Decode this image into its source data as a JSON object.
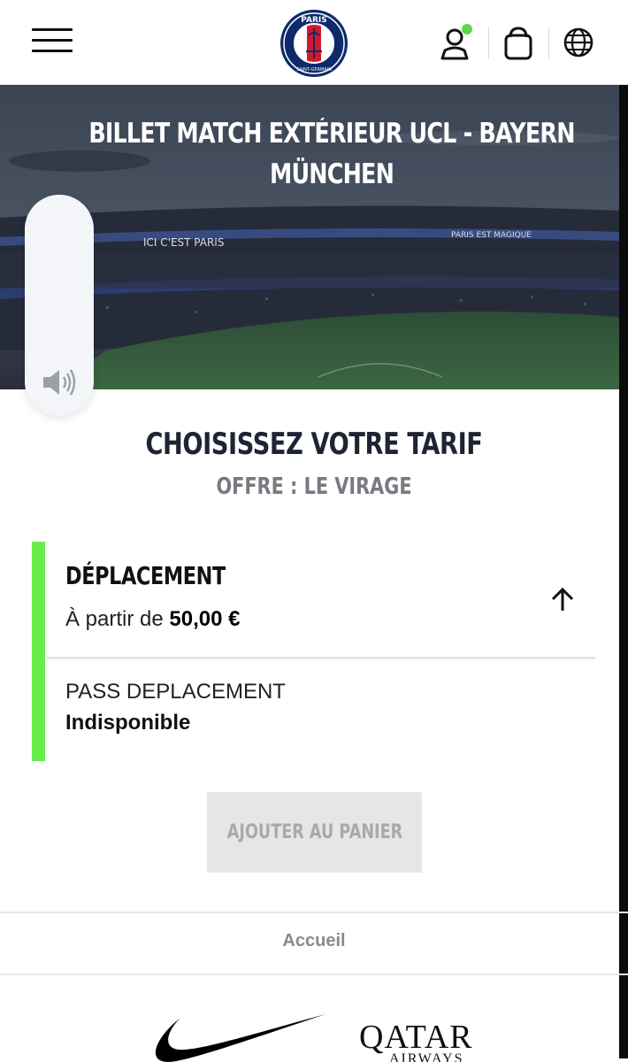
{
  "header": {
    "logo": {
      "top_text": "PARIS",
      "bottom_text": "SAINT-GERMAIN"
    },
    "icons": [
      "menu-icon",
      "account-icon",
      "bag-icon",
      "globe-icon"
    ],
    "account_badge_color": "#5dd94a"
  },
  "hero": {
    "title": "BILLET MATCH EXTÉRIEUR UCL - BAYERN MÜNCHEN",
    "title_line1": "BILLET MATCH EXTÉRIEUR UCL - BAYERN",
    "title_line2": "MÜNCHEN",
    "stadium_banners": [
      "ICI C'EST PARIS",
      "PARIS EST MAGIQUE"
    ]
  },
  "selection": {
    "title": "CHOISISSEZ VOTRE TARIF",
    "offer": "OFFRE : LE VIRAGE"
  },
  "tariff": {
    "category": "DÉPLACEMENT",
    "from_label": "À partir de",
    "from_price": "50,00 €",
    "accent_color": "#66ee4a",
    "items": [
      {
        "name": "PASS DEPLACEMENT",
        "status": "Indisponible"
      }
    ]
  },
  "cart": {
    "add_label": "AJOUTER AU PANIER"
  },
  "footer": {
    "breadcrumb": "Accueil",
    "sponsors": {
      "nike": "nike-swoosh-logo",
      "qatar_main": "QATAR",
      "qatar_sub": "AIRWAYS"
    }
  }
}
